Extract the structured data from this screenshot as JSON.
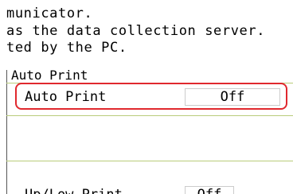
{
  "description": {
    "line1": "municator.",
    "line2": "as the data collection server.",
    "line3": "ted by the PC."
  },
  "auto_print_group": {
    "title": "Auto Print",
    "row_label": "Auto Print",
    "row_value": "Off"
  },
  "bottom_row": {
    "label": "Up/Low Print",
    "value": "Off"
  },
  "colors": {
    "highlight": "#e0282e",
    "separator": "#b9cc7a"
  }
}
